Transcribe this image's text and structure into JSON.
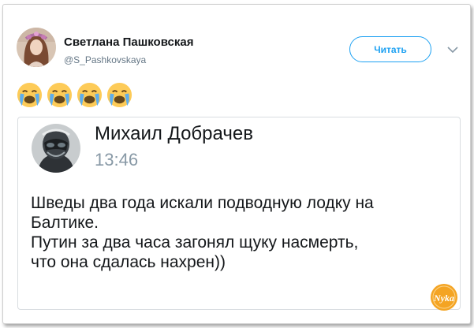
{
  "tweet": {
    "author_name": "Светлана Пашковская",
    "author_handle": "@S_Pashkovskaya",
    "follow_label": "Читать",
    "emoji": [
      "loudly-crying-face",
      "loudly-crying-face",
      "loudly-crying-face",
      "loudly-crying-face"
    ]
  },
  "embedded_post": {
    "author_name": "Михаил Добрачев",
    "time": "13:46",
    "lines": [
      "Шведы два года искали подводную лодку на",
      "Балтике.",
      "Путин за два часа загонял щуку насмерть,",
      "что она сдалась нахрен))"
    ]
  },
  "watermark": {
    "text": "Nyka"
  },
  "colors": {
    "accent": "#1da1f2",
    "text": "#14171a",
    "muted": "#657786",
    "time": "#8899a6",
    "watermark": "#f4a423"
  }
}
